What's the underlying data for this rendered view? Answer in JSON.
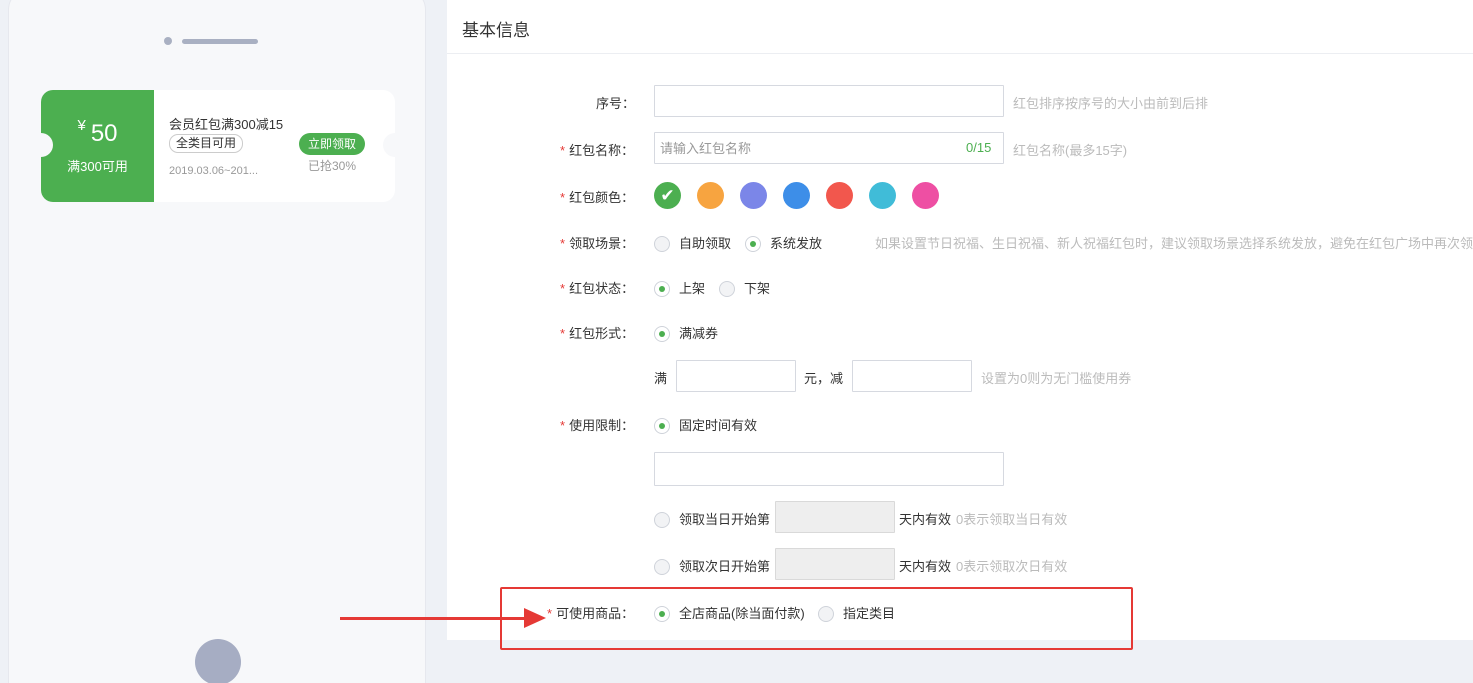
{
  "coupon": {
    "currency": "¥",
    "amount": "50",
    "condition": "满300可用",
    "name": "会员红包满300减15",
    "tag": "全类目可用",
    "date": "2019.03.06~201...",
    "grab_label": "立即领取",
    "grab_rate": "已抢30%"
  },
  "section_title": "基本信息",
  "form": {
    "seq": {
      "label": "序号：",
      "value": "",
      "hint": "红包排序按序号的大小由前到后排"
    },
    "name": {
      "label": "红包名称：",
      "placeholder": "请输入红包名称",
      "counter": "0/15",
      "hint": "红包名称(最多15字)"
    },
    "color": {
      "label": "红包颜色：",
      "options": [
        "#4caf50",
        "#f7a440",
        "#7b86e8",
        "#3d8ee8",
        "#f2574d",
        "#40bcd8",
        "#ee4fa3"
      ],
      "selected_index": 0
    },
    "scene": {
      "label": "领取场景：",
      "options": [
        "自助领取",
        "系统发放"
      ],
      "selected": "系统发放",
      "hint": "如果设置节日祝福、生日祝福、新人祝福红包时，建议领取场景选择系统发放，避免在红包广场中再次领"
    },
    "status": {
      "label": "红包状态：",
      "options": [
        "上架",
        "下架"
      ],
      "selected": "上架"
    },
    "form_type": {
      "label": "红包形式：",
      "options": [
        "满减券"
      ],
      "selected": "满减券"
    },
    "threshold": {
      "prefix": "满",
      "middle": "元，减",
      "min_value": "",
      "off_value": "",
      "hint": "设置为0则为无门槛使用券"
    },
    "limit": {
      "label": "使用限制：",
      "option_fixed": "固定时间有效",
      "fixed_value": "",
      "option_same_day": "领取当日开始第",
      "option_next_day": "领取次日开始第",
      "days_suffix": "天内有效",
      "hint_same_day": "0表示领取当日有效",
      "hint_next_day": "0表示领取次日有效",
      "selected": "固定时间有效"
    },
    "goods": {
      "label": "可使用商品：",
      "options": [
        "全店商品(除当面付款)",
        "指定类目"
      ],
      "selected": "全店商品(除当面付款)"
    }
  },
  "required_mark": "*"
}
